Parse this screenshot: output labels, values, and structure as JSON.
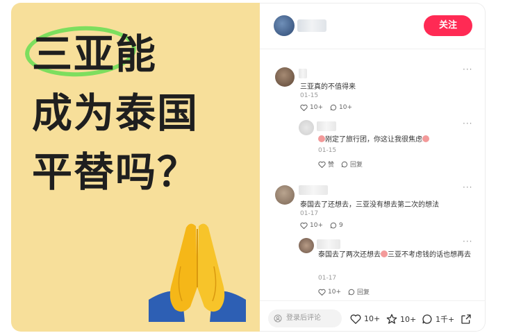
{
  "post": {
    "headline_lines": [
      "三亚能",
      "成为泰国",
      "平替吗？"
    ],
    "highlight_color": "#7dde5e",
    "background_color": "#f7df9a"
  },
  "author": {
    "follow_label": "关注",
    "follow_color": "#ff2a54"
  },
  "comments": [
    {
      "text": "三亚真的不值得来",
      "date": "01-15",
      "likes": "10+",
      "replies": "10+",
      "reply": {
        "text_before": "刚定了旅行团，你这让我很焦虑",
        "date": "01-15",
        "like_label": "赞",
        "reply_label": "回复"
      }
    },
    {
      "text": "泰国去了还想去，三亚没有想去第二次的想法",
      "date": "01-17",
      "likes": "10+",
      "replies": "9",
      "reply": {
        "text_part1": "泰国去了两次还想去",
        "text_part2": "三亚不考虑钱的话也想再去",
        "date": "01-17",
        "likes": "10+",
        "reply_label": "回复"
      }
    }
  ],
  "bottom": {
    "input_placeholder": "登录后评论",
    "likes": "10+",
    "collects": "10+",
    "comments": "1千+"
  },
  "icons": [
    "user-icon",
    "heart-icon",
    "star-icon",
    "comment-icon",
    "share-icon",
    "more-icon",
    "emoji-icon",
    "praying-hands-icon"
  ]
}
